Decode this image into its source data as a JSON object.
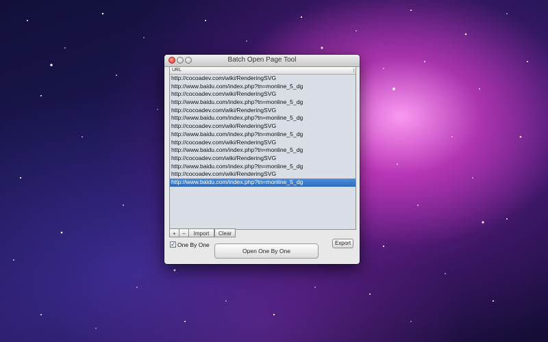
{
  "window": {
    "title": "Batch Open Page Tool"
  },
  "list": {
    "column_header": "URL",
    "rows": [
      "http://cocoadev.com/wiki/RenderingSVG",
      "http://www.baidu.com/index.php?tn=monline_5_dg",
      "http://cocoadev.com/wiki/RenderingSVG",
      "http://www.baidu.com/index.php?tn=monline_5_dg",
      "http://cocoadev.com/wiki/RenderingSVG",
      "http://www.baidu.com/index.php?tn=monline_5_dg",
      "http://cocoadev.com/wiki/RenderingSVG",
      "http://www.baidu.com/index.php?tn=monline_5_dg",
      "http://cocoadev.com/wiki/RenderingSVG",
      "http://www.baidu.com/index.php?tn=monline_5_dg",
      "http://cocoadev.com/wiki/RenderingSVG",
      "http://www.baidu.com/index.php?tn=monline_5_dg",
      "http://cocoadev.com/wiki/RenderingSVG",
      "http://www.baidu.com/index.php?tn=monline_5_dg"
    ],
    "selected_index": 13
  },
  "toolbar": {
    "add_label": "+",
    "remove_label": "−",
    "import_label": "Import",
    "clear_label": "Clear"
  },
  "options": {
    "one_by_one_label": "One By One",
    "one_by_one_checked": true
  },
  "actions": {
    "open_label": "Open One By One",
    "export_label": "Export"
  },
  "colors": {
    "selection": "#2d6ac1",
    "close_button": "#d6352a"
  }
}
